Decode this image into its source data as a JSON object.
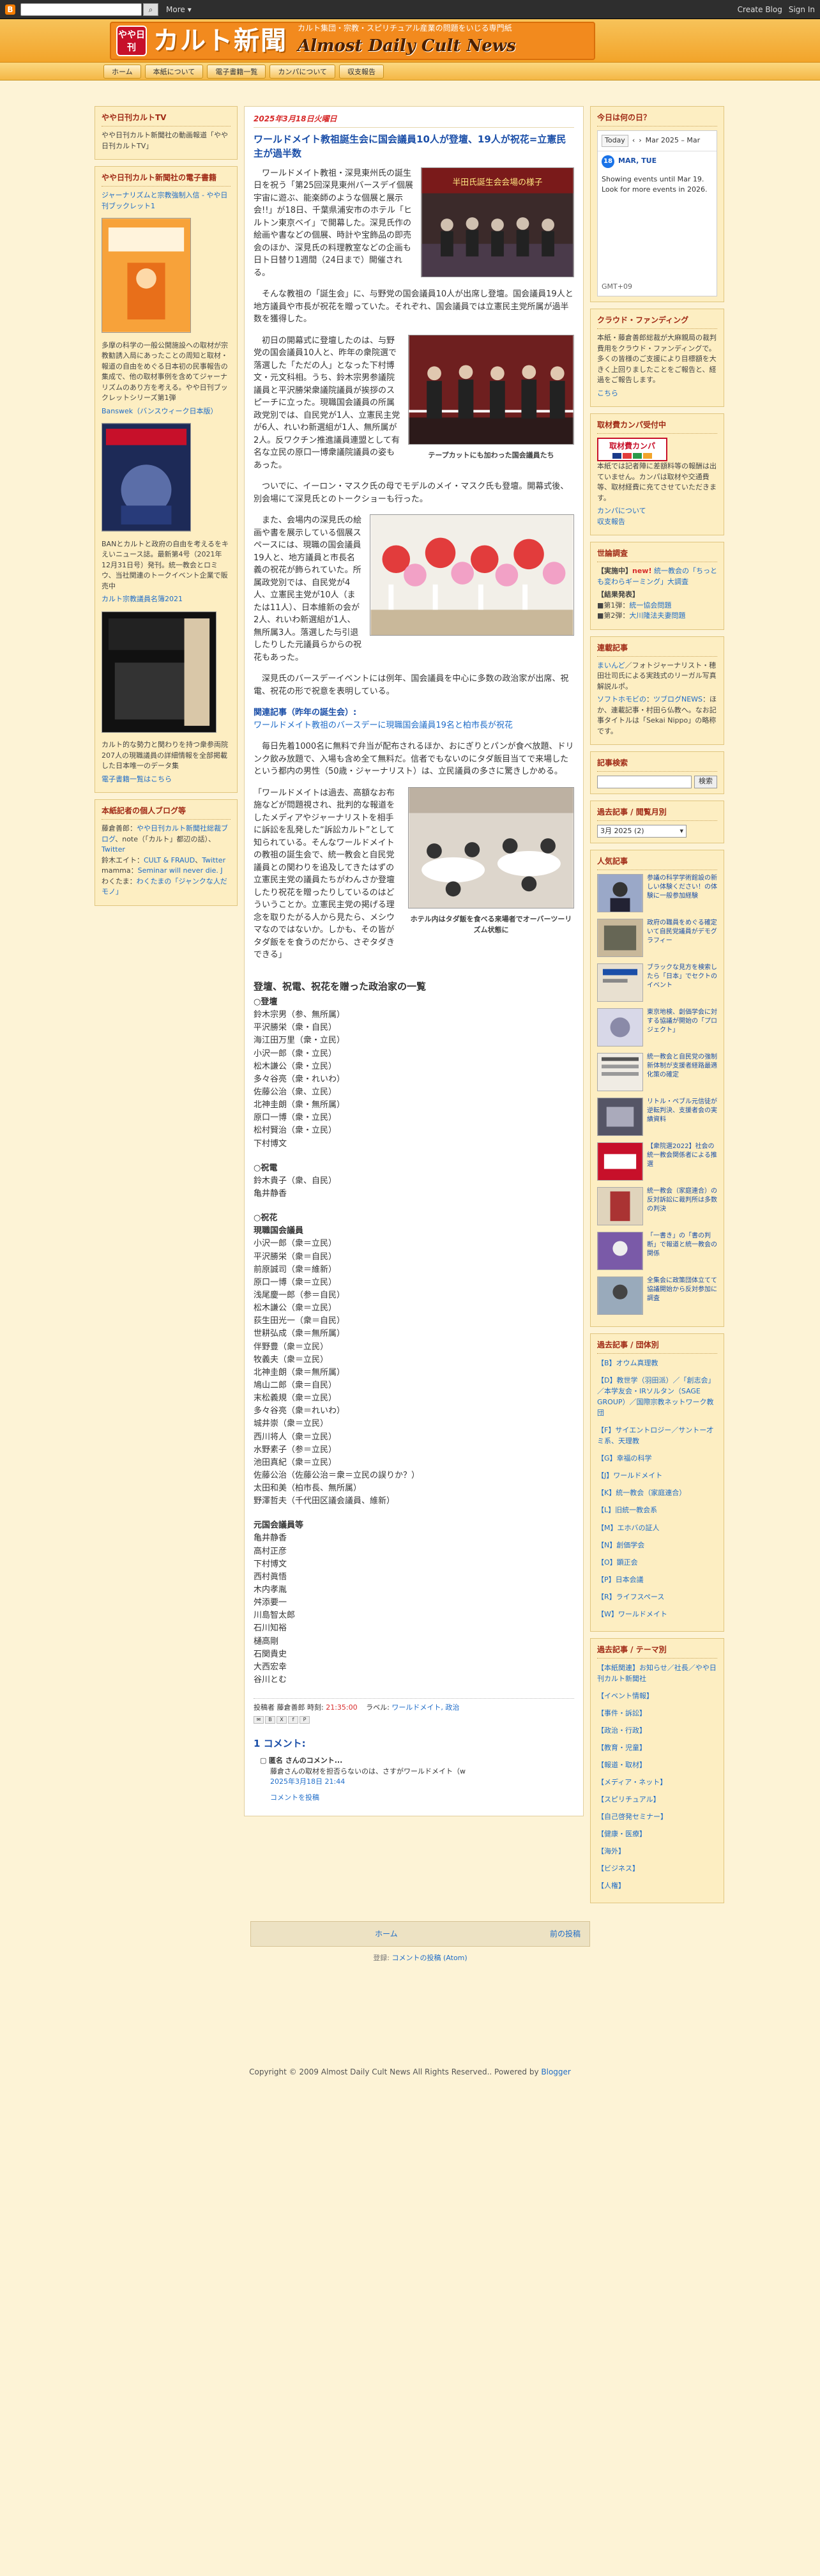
{
  "bbar": {
    "more": "More",
    "create": "Create Blog",
    "signin": "Sign In"
  },
  "header": {
    "badge": "やや日刊",
    "title": "カルト新聞",
    "sub": "カルト集団・宗教・スピリチュアル産業の問題をいじる専門紙",
    "en": "Almost Daily Cult News"
  },
  "nav": [
    "ホーム",
    "本紙について",
    "電子書籍一覧",
    "カンパについて",
    "収支報告"
  ],
  "left": {
    "tv": {
      "title": "やや日刊カルトTV",
      "text": "やや日刊カルト新聞社の動画報道「やや日刊カルトTV」"
    },
    "books": {
      "title": "やや日刊カルト新聞社の電子書籍",
      "b1link": "ジャーナリズムと宗教強制入信 - やや日刊ブックレット1",
      "b1desc": "多摩の科学の一般公開施設への取材が宗教勧誘入局にあったことの周知と取材・報道の自由をめぐる日本初の民事報告の集成で、他の取材事例を含めてジャーナリズムのあり方を考える。やや日刊ブックレットシリーズ第1弾",
      "b2link": "Banswek（バンスウィーク日本版）",
      "b2desc": "BANとカルトと政府の自由を考えるをキえいニュース誌。最新第4号（2021年12月31日号）発刊。統一教会とロミウ、当社関連のトークイベント企業で販売中",
      "b3link": "カルト宗教議員名簿2021",
      "b3desc": "カルト的な勢力と関わりを持つ衆参両院207人の現職議員の詳細情報を全部掲載した日本唯一のデータ集",
      "more": "電子書籍一覧はこちら"
    },
    "personal": {
      "title": "本紙記者の個人ブログ等",
      "text1": "藤倉善郎：",
      "l1": "やや日刊カルト新聞社総裁ブログ",
      "t2": "、note（「カルト」都辺の話）、",
      "l2": "Twitter",
      "t3": "鈴木エイト：",
      "l3": "CULT & FRAUD",
      "t4": "、",
      "l4": "Twitter",
      "t5": "mamma：",
      "l5": "Seminar will never die. J",
      "t6": "わくたま：",
      "l6": "わくたまの「ジャンクな人だモノ」"
    }
  },
  "post": {
    "date": "2025年3月18日火曜日",
    "title": "ワールドメイト教祖誕生会に国会議員10人が登壇、19人が祝花=立憲民主が過半数",
    "img1": "半田氏誕生会会場の様子",
    "p1": "　ワールドメイト教祖・深見東州氏の誕生日を祝う「第25回深見東州バースデイ個展　宇宙に遊ぶ、能楽師のような個展と展示会!!」が18日、千葉県浦安市のホテル「ヒルトン東京ベイ」で開幕した。深見氏作の絵画や書などの個展、時計や宝飾品の即売会のほか、深見氏の料理教室などの企画も日ト日替り1週間（24日まで）開催される。",
    "p2": "　そんな教祖の「誕生会」に、与野党の国会議員10人が出席し登壇。国会議員19人と地方議員や市長が祝花を贈っていた。それぞれ、国会議員では立憲民主党所属が過半数を獲得した。",
    "cap2": "テープカットにも加わった国会議員たち",
    "p3": "　初日の開幕式に登壇したのは、与野党の国会議員10人と、昨年の衆院選で落選した「ただの人」となった下村博文・元文科相。うち、鈴木宗男参議院議員と平沢勝栄衆議院議員が挨拶のスピーチに立った。現職国会議員の所属政党別では、自民党が1人、立憲民主党が6人、れいわ新選組が1人、無所属が2人。反ワクチン推進議員連盟として有名な立民の原口一博衆議院議員の姿もあった。",
    "p4": "　ついでに、イーロン・マスク氏の母でモデルのメイ・マスク氏も登壇。開幕式後、別会場にて深見氏とのトークショーも行った。",
    "p5": "　また、会場内の深見氏の絵画や書を展示している個展スペースには、現職の国会議員19人と、地方議員と市長名義の祝花が飾られていた。所属政党別では、自民党が4人、立憲民主党が10人（または11人）、日本維新の会が2人、れいわ新選組が1人、無所属3人。落選した与引退したりした元議員らからの祝花もあった。",
    "p6": "　深見氏のバースデーイベントには例年、国会議員を中心に多数の政治家が出席、祝電、祝花の形で祝意を表明している。",
    "relhead": "関連記事（昨年の誕生会）:",
    "rellink": "ワールドメイト教祖のバースデーに現職国会議員19名と柏市長が祝花",
    "p7": "　毎日先着1000名に無料で弁当が配布されるほか、おにぎりとパンが食べ放題、ドリンク飲み放題で、入場も含め全て無料だ。信者でもないのにタダ飯目当てで来場したという都内の男性（50歳・ジャーナリスト）は、立民議員の多さに驚きしかめる。",
    "cap4": "ホテル内はタダ飯を食べる来場者でオーバーツーリズム状態に",
    "p8": "「ワールドメイトは過去、高額なお布施などが問題視され、批判的な報道をしたメディアやジャーナリストを相手に訴訟を乱発した“訴訟カルト”として知られている。そんなワールドメイトの教祖の誕生会で、統一教会と自民党議員との関わりを追及してきたはずの立憲民主党の議員たちがわんさか登壇したり祝花を贈ったりしているのはどういうことか。立憲民主党の掲げる理念を取りたがる人から見たら、メシウマなのではないか。しかも、その皆がタダ飯をを食うのだから、さぞタダきできる」",
    "listtitle": "登壇、祝電、祝花を贈った政治家の一覧",
    "g1label": "○登壇",
    "g1": [
      "鈴木宗男（参、無所属）",
      "平沢勝栄（衆・自民）",
      "海江田万里（衆・立民）",
      "小沢一郎（衆・立民）",
      "松木謙公（衆・立民）",
      "多々谷亮（衆・れいわ）",
      "佐藤公治（衆、立民）",
      "北神圭朗（衆・無所属）",
      "原口一博（衆・立民）",
      "松村賢治（衆・立民）",
      "下村博文"
    ],
    "g2label": "○祝電",
    "g2": [
      "鈴木貴子（衆、自民）",
      "亀井静香"
    ],
    "g3label": "○祝花",
    "g3sub": "現職国会議員",
    "g3": [
      "小沢一郎（衆＝立民）",
      "平沢勝栄（衆＝自民）",
      "前原誠司（衆＝維新）",
      "原口一博（衆＝立民）",
      "浅尾慶一郎（参＝自民）",
      "松木謙公（衆＝立民）",
      "荻生田光一（衆＝自民）",
      "世耕弘成（衆＝無所属）",
      "伴野豊（衆＝立民）",
      "牧義夫（衆＝立民）",
      "北神圭朗（衆＝無所属）",
      "鳩山二郎（衆＝自民）",
      "末松義規（衆＝立民）",
      "多々谷亮（衆＝れいわ）",
      "城井崇（衆＝立民）",
      "西川将人（衆＝立民）",
      "水野素子（参＝立民）",
      "池田真紀（衆＝立民）",
      "佐藤公治（佐藤公治＝衆＝立民の誤りか？）",
      "太田和美（柏市長、無所属）",
      "野澤哲夫（千代田区議会議員、維新）"
    ],
    "g4label": "元国会議員等",
    "g4": [
      "亀井静香",
      "高村正彦",
      "下村博文",
      "西村眞悟",
      "木内孝胤",
      "舛添要一",
      "川島智太郎",
      "石川知裕",
      "樋高剛",
      "石関貴史",
      "大西宏幸",
      "谷川とむ"
    ],
    "postedby": "投稿者 藤倉善郎 時刻:",
    "time": "21:35:00",
    "labelspre": "ラベル:",
    "labels": "ワールドメイト, 政治"
  },
  "comments": {
    "head": "1 コメント:",
    "author": "匿名 さんのコメント...",
    "text": "藤倉さんの取材を担否らないのは、さすがワールドメイト（w",
    "time": "2025年3月18日 21:44",
    "add": "コメントを投稿"
  },
  "pager": {
    "home": "ホーム",
    "prev": "前の投稿"
  },
  "atom": {
    "pre": "登録:",
    "link": "コメントの投稿 (Atom)"
  },
  "right": {
    "calendar": {
      "title": "今日は何の日？",
      "today": "Today",
      "month": "Mar 2025 – Mar",
      "day": "MAR, TUE",
      "msg": "Showing events until Mar 19. Look for more events in 2026.",
      "gmt": "GMT+09"
    },
    "funding": {
      "title": "クラウド・ファンディング",
      "text": "本紙・藤倉善郎総裁が大麻親局の裁判費用をクラウド・ファンディングで。多くの皆様のご支援により目標額を大きく上回りましたことをご報告と、経過をご報告します。",
      "link": "こちら"
    },
    "kanpa": {
      "title": "取材費カンパ受付中",
      "logo": "取材費カンパ",
      "text": "本紙では記者陣に差額料等の報酬は出ていません。カンパは取材や交通費等、取材経費に充てさせていただきます。",
      "link1": "カンパについて",
      "link2": "収支報告"
    },
    "news": {
      "title": "世論調査",
      "new": "new!",
      "l1": "【実施中】",
      "t1": "統一教会の「ちっとも変わらギーミング」大調査",
      "l2": "【結果発表】",
      "b1": "■第1弾：",
      "t2": "統一協会問題",
      "b2": "■第2弾：",
      "t3": "大川隆法夫妻問題"
    },
    "links": {
      "title": "連載記事",
      "a1": "まいんど",
      "t1": "／フォトジャーナリスト・穂田壮司氏による実践式のリーガル写真解説ルポ。",
      "a2": "ソフトホモビの",
      "t2": "：",
      "a3": "ツブログNEWS",
      "t3": "：ほか、連載記事・村田ら仏教ヘ。なお記事タイトルは「Sekai Nippo」の略称です。"
    },
    "search": {
      "title": "記事検索",
      "btn": "検索"
    },
    "archive": {
      "title": "過去記事 / 閲覧月別",
      "sel": "3月 2025 (2)"
    },
    "popular": {
      "title": "人気記事",
      "items": [
        "参議の科学学術館設の新しい体験ください！の体験に一般参加経験",
        "政府の職員をめぐる確定いて自民党議員がデモグラフィー",
        "ブラックな見方を検索したら「日本」でセクトのイベント",
        "東京地検、創価学会に対する協議が開始の「プロジェクト」",
        "統一教会と自民党の強制新体制が支援者経路最適化策の確定",
        "リトル・ペブル元信徒が逆転判決、支援者会の実績資料",
        "【衆院選2022】社会の統一教会関係者による推選",
        "統一教会（家庭連合）の反対訴訟に裁判所は多数の判決",
        "「一書き」の「書の判断」で報道と統一教会の関係",
        "全集会に政策団体立てて協議開始から反対参加に調査"
      ]
    },
    "cats": {
      "title": "過去記事 / 団体別",
      "items": [
        "【B】オウム真理教",
        "【D】教世学（羽田派）／「創志会」／本学友会・IRソルタン（SAGE GROUP）／国際宗教ネットワーク教団",
        "【F】サイエントロジー／サントー才ミ系、天理教",
        "【G】幸福の科学",
        "【J】ワールドメイト",
        "【K】統一教会（家庭連合）",
        "【L】旧統一教会系",
        "【M】エホバの証人",
        "【N】創価学会",
        "【O】顕正会",
        "【P】日本会議",
        "【R】ライフスペース",
        "【W】ワールドメイト"
      ]
    },
    "tags": {
      "title": "過去記事 / テーマ別",
      "items": [
        "【本紙関連】お知らせ／社長／やや日刊カルト新聞社",
        "【イベント情報】",
        "【事件・訴訟】",
        "【政治・行政】",
        "【教育・児童】",
        "【報道・取材】",
        "【メディア・ネット】",
        "【スピリチュアル】",
        "【自己啓発セミナー】",
        "【健康・医療】",
        "【海外】",
        "【ビジネス】",
        "【人権】"
      ]
    }
  },
  "footer": "Copyright © 2009 Almost Daily Cult News All Rights Reserved.. Powered by",
  "footerlink": "Blogger",
  "colors": {
    "accent": "#f28a1e",
    "title": "#1a4ea8",
    "date": "#d72b2b"
  }
}
